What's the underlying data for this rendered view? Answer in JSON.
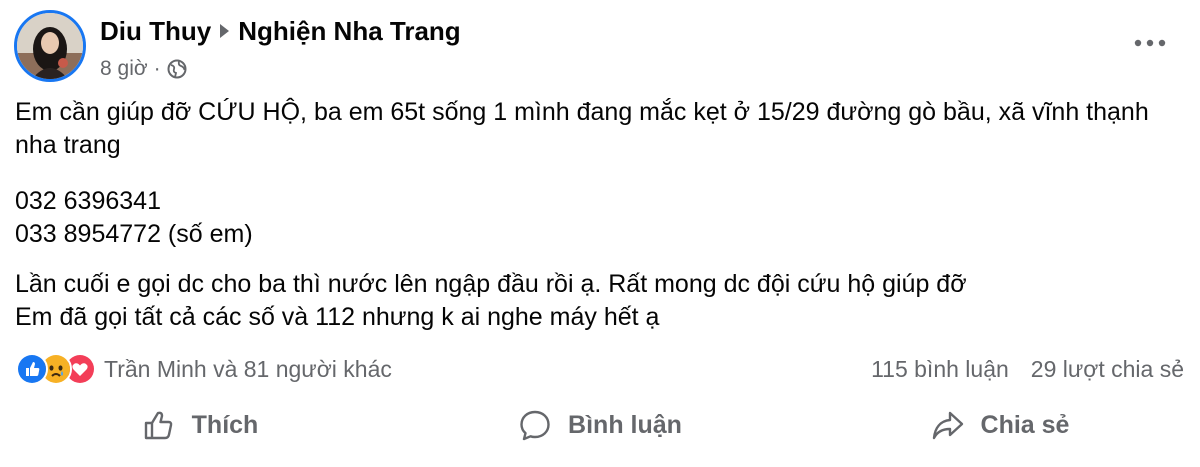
{
  "post": {
    "author": "Diu Thuy",
    "group": "Nghiện Nha Trang",
    "time": "8 giờ",
    "separator": "·",
    "visibility_icon": "globe-icon",
    "paragraph1": "Em cần giúp đỡ CỨU HỘ, ba em 65t sống 1 mình đang mắc kẹt ở 15/29 đường gò bầu, xã vĩnh thạnh nha trang",
    "phone1": "032 6396341",
    "phone2": "033 8954772 (số em)",
    "paragraph3_line1": "Lần cuối e gọi dc cho ba thì nước lên ngập đầu rồi ạ. Rất mong dc đội cứu hộ giúp đỡ",
    "paragraph3_line2": "Em đã gọi tất cả các số và 112 nhưng k ai nghe máy hết ạ"
  },
  "reactions": {
    "icons": [
      "like-icon",
      "sad-icon",
      "love-icon"
    ],
    "summary": "Trần Minh và 81 người khác",
    "comments": "115 bình luận",
    "shares": "29 lượt chia sẻ"
  },
  "actions": {
    "like": "Thích",
    "comment": "Bình luận",
    "share": "Chia sẻ"
  },
  "colors": {
    "text": "#050505",
    "secondary": "#65676b",
    "accent": "#1877f2",
    "love": "#f33e58",
    "sad": "#f7b125"
  }
}
